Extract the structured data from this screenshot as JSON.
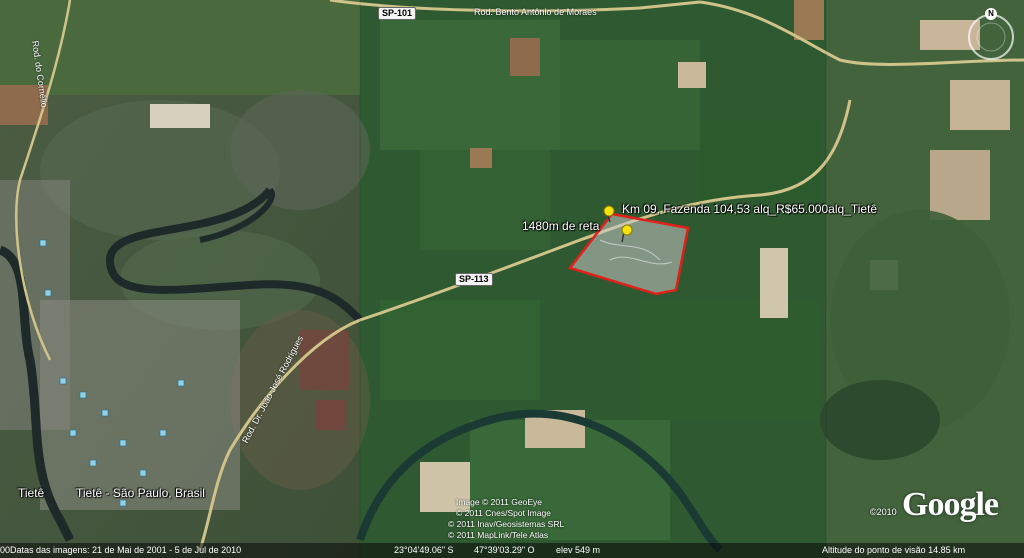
{
  "placemarks": {
    "farm_label": "Km 09, Fazenda 104,53 alq_R$65.000alq_Tietê",
    "distance_label": "1480m de reta"
  },
  "roads": {
    "sp101": "SP-101",
    "sp113": "SP-113",
    "bento": "Rod. Bento Antônio de Moraes",
    "cornelio": "Rod. do Cornélio",
    "joao": "Rod. Dr. João José Rodrigues"
  },
  "places": {
    "tiete": "Tietê",
    "tiete_sp": "Tietê - São Paulo, Brasil"
  },
  "copyright": [
    "Image © 2011 GeoEye",
    "© 2011 Cnes/Spot Image",
    "© 2011 Inav/Geosistemas SRL",
    "© 2011 MapLink/Tele Atlas"
  ],
  "logo": {
    "text": "Google",
    "year": "©2010"
  },
  "compass": {
    "north": "N"
  },
  "statusbar": {
    "left_edge": "00",
    "dates": "Datas das imagens: 21 de Mai de 2001 - 5 de Jul de 2010",
    "lat": "23°04'49.06\" S",
    "lon": "47°39'03.29\" O",
    "elev": "elev  549 m",
    "eye_alt": "Altitude do ponto de visão   14.85 km"
  }
}
